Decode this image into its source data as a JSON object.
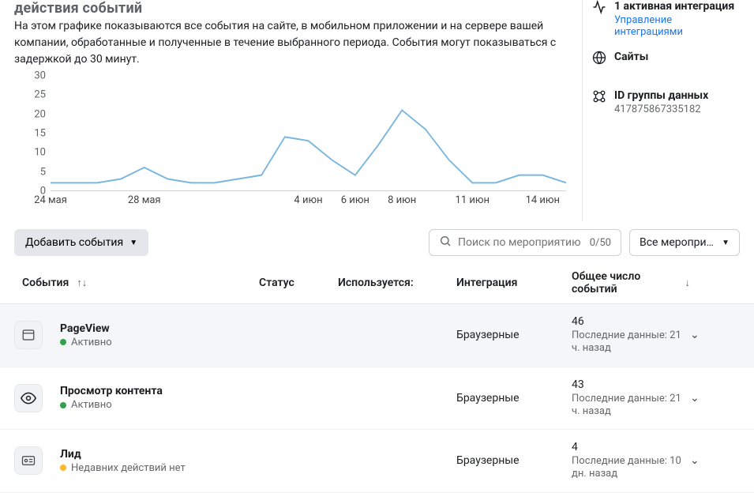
{
  "header": {
    "title_truncated": "действия событий",
    "description": "На этом графике показываются все события на сайте, в мобильном приложении и на сервере вашей компании, обработанные и полученные в течение выбранного периода. События могут показываться с задержкой до 30 минут."
  },
  "chart_data": {
    "type": "line",
    "x": [
      "24 мая",
      "25 мая",
      "26 мая",
      "27 мая",
      "28 мая",
      "29 мая",
      "30 мая",
      "31 мая",
      "1 июн",
      "2 июн",
      "3 июн",
      "4 июн",
      "5 июн",
      "6 июн",
      "7 июн",
      "8 июн",
      "9 июн",
      "10 июн",
      "11 июн",
      "12 июн",
      "13 июн",
      "14 июн",
      "15 июн"
    ],
    "values": [
      2,
      2,
      2,
      3,
      6,
      3,
      2,
      2,
      3,
      4,
      14,
      13,
      8,
      4,
      12,
      21,
      16,
      8,
      2,
      2,
      4,
      4,
      2
    ],
    "x_ticks": [
      "24 мая",
      "28 мая",
      "4 июн",
      "6 июн",
      "8 июн",
      "11 июн",
      "14 июн"
    ],
    "y_ticks": [
      0,
      5,
      10,
      15,
      20,
      25,
      30
    ],
    "ylim": [
      0,
      30
    ],
    "xlabel": "",
    "ylabel": "",
    "title": ""
  },
  "side": {
    "integration_title": "1 активная интеграция",
    "integration_link": "Управление интеграциями",
    "sites_title": "Сайты",
    "group_title": "ID группы данных",
    "group_value": "417875867335182"
  },
  "toolbar": {
    "add_button": "Добавить события",
    "search_placeholder": "Поиск по мероприятию",
    "search_count": "0/50",
    "filter_label": "Все мероприя…"
  },
  "table": {
    "headers": {
      "event": "События",
      "status": "Статус",
      "used": "Используется:",
      "integration": "Интеграция",
      "total": "Общее число событий"
    },
    "rows": [
      {
        "icon": "window",
        "name": "PageView",
        "status_label": "Активно",
        "status_color": "green",
        "integration": "Браузерные",
        "total": "46",
        "last_data": "Последние данные: 21 ч. назад"
      },
      {
        "icon": "eye",
        "name": "Просмотр контента",
        "status_label": "Активно",
        "status_color": "green",
        "integration": "Браузерные",
        "total": "43",
        "last_data": "Последние данные: 21 ч. назад"
      },
      {
        "icon": "idcard",
        "name": "Лид",
        "status_label": "Недавних действий нет",
        "status_color": "amber",
        "integration": "Браузерные",
        "total": "4",
        "last_data": "Последние данные: 10 дн. назад"
      }
    ]
  }
}
